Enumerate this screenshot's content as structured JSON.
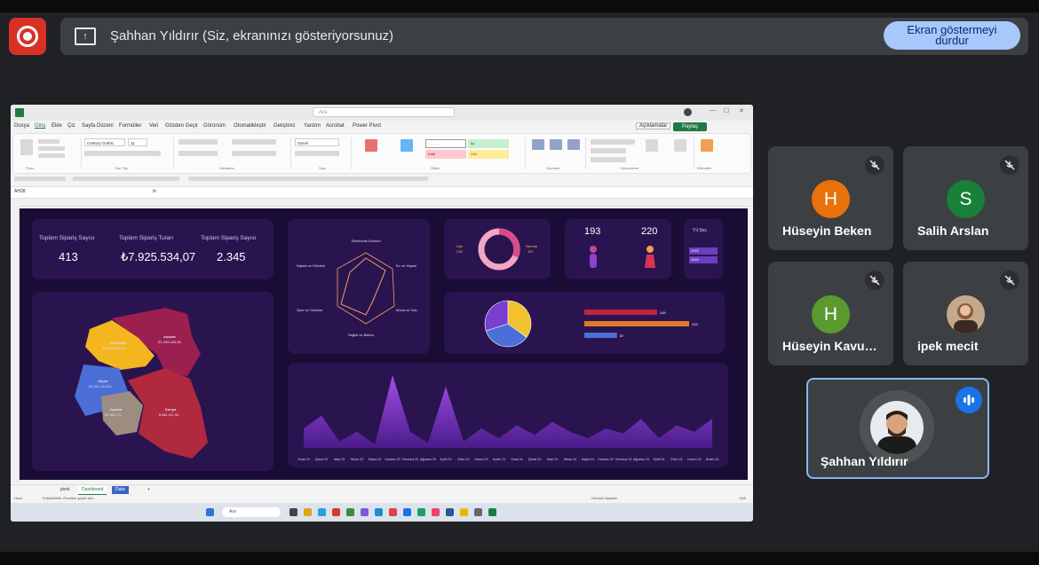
{
  "meet": {
    "banner_text": "Şahhan Yıldırır (Siz, ekranınızı gösteriyorsunuz)",
    "stop_button": "Ekran göstermeyi durdur"
  },
  "participants": [
    {
      "name": "Hüseyin Beken",
      "initial": "H",
      "color": "#e8710a"
    },
    {
      "name": "Salih Arslan",
      "initial": "S",
      "color": "#188038"
    },
    {
      "name": "Hüseyin Kavu…",
      "initial": "H",
      "color": "#5a9a2e"
    },
    {
      "name": "ipek mecit",
      "initial": "",
      "color": "#c5a88c"
    }
  ],
  "speaker": {
    "name": "Şahhan Yıldırır"
  },
  "excel": {
    "search_placeholder": "Ara",
    "menu": [
      "Dosya",
      "Giriş",
      "Ekle",
      "Çiz",
      "Sayfa Düzeni",
      "Formüller",
      "Veri",
      "Gözden Geçir",
      "Görünüm",
      "Otomatikleştir",
      "Geliştirici",
      "Yardım",
      "Acrobat",
      "Power Pivot"
    ],
    "comments_label": "Açıklamalar",
    "share_label": "Paylaş",
    "cell_ref": "AH28",
    "fx": "fx",
    "style_labels": {
      "normal": "Normal",
      "iyi": "İyi",
      "kotu": "Kötü",
      "notr": "Nötr"
    },
    "font_name": "Century Gothic",
    "font_size": "11",
    "number_format": "Genel",
    "group_labels": [
      "Pano",
      "Yazı Tipi",
      "Hizalama",
      "Sayı",
      "Stiller",
      "Hücreler",
      "Düzenleme",
      "Eklentiler"
    ],
    "sheet_tabs": [
      "pivot",
      "Dashboard",
      "Data"
    ],
    "status_left": "Hazır",
    "status_access": "Erişilebilirlik: Önerilen şeyler alın",
    "status_display": "Görüntü Ayarları",
    "zoom": "%45"
  },
  "dashboard": {
    "kpis": [
      {
        "label": "Toplam Sipariş Sayısı",
        "value": "413"
      },
      {
        "label": "Toplam Sipariş Tutarı",
        "value": "₺7.925.534,07"
      },
      {
        "label": "Toplam Sipariş Sayısı",
        "value": "2.345"
      }
    ],
    "map_regions": [
      {
        "name": "Eskişehir",
        "value": "₺1.608.065,43",
        "color": "#f3b61f"
      },
      {
        "name": "Ankara",
        "value": "₺1.455.406,56",
        "color": "#9b1f4f"
      },
      {
        "name": "Afyon",
        "value": "₺1.251.119,84",
        "color": "#4b6fd6"
      },
      {
        "name": "Isparta",
        "value": "₺2.581.71..",
        "color": "#9d8d80"
      },
      {
        "name": "Konya",
        "value": "₺484.411,53",
        "color": "#b0293d"
      }
    ],
    "radar_labels": [
      "Elektronik Ürünleri",
      "Ev ve Yaşam",
      "Moda ve Takı",
      "Sağlık ve Bakım",
      "Spor ve Outdoor",
      "Kişisel ve Ürünleri"
    ],
    "donut": {
      "left_label": "Üye",
      "left_value": "216",
      "right_label": "Normal",
      "right_value": "197"
    },
    "gender": {
      "male": "193",
      "female": "220"
    },
    "year_filter": {
      "title": "Yıl Seç",
      "options": [
        "2023",
        "2024"
      ]
    },
    "bars": {
      "values": [
        149,
        215,
        67
      ]
    }
  },
  "chart_data": [
    {
      "type": "area",
      "title": "",
      "x": [
        "Ocak 23",
        "Şubat 23",
        "Mart 23",
        "Nisan 23",
        "Mayıs 23",
        "Haziran 23",
        "Temmuz 23",
        "Ağustos 23",
        "Eylül 23",
        "Ekim 23",
        "Kasım 23",
        "Aralık 23",
        "Ocak 24",
        "Şubat 24",
        "Mart 24",
        "Nisan 24",
        "Mayıs 24",
        "Haziran 24",
        "Temmuz 24",
        "Ağustos 24",
        "Eylül 24",
        "Ekim 24",
        "Kasım 24",
        "Aralık 24"
      ],
      "values": [
        12,
        20,
        4,
        10,
        2,
        45,
        10,
        3,
        38,
        4,
        12,
        6,
        14,
        8,
        16,
        10,
        6,
        12,
        9,
        18,
        6,
        14,
        10,
        18
      ]
    },
    {
      "type": "bar",
      "orientation": "horizontal",
      "values": [
        149,
        215,
        67
      ],
      "colors": [
        "#c0263a",
        "#e07a2c",
        "#4b6fd6"
      ]
    },
    {
      "type": "pie",
      "values": [
        35,
        35,
        30
      ],
      "colors": [
        "#f2c12e",
        "#4b6fd6",
        "#7a3fd0"
      ]
    }
  ]
}
